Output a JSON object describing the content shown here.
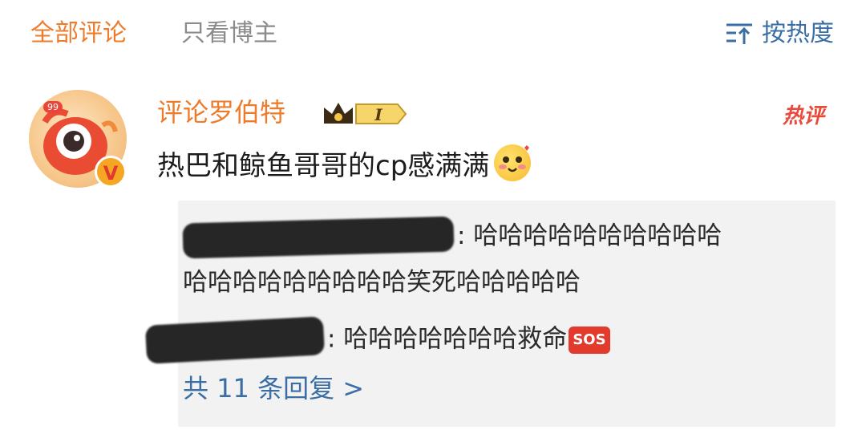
{
  "tabs": {
    "all_comments": "全部评论",
    "blogger_only": "只看博主",
    "sort_label": "按热度",
    "sort_icon": "sort-icon"
  },
  "comment": {
    "avatar_badge": "99",
    "verified_mark": "V",
    "username": "评论罗伯特",
    "level_badge": "I",
    "hot_tag": "热评",
    "text": "热巴和鲸鱼哥哥的cp感满满",
    "emoji": "blushing-face-emoji"
  },
  "replies": {
    "reply1_prefix": ":",
    "reply1_line1": " 哈哈哈哈哈哈哈哈哈哈",
    "reply1_line2": "哈哈哈哈哈哈哈哈哈笑死哈哈哈哈哈",
    "reply2_prefix": ":",
    "reply2_text": " 哈哈哈哈哈哈哈救命",
    "reply2_badge": "SOS",
    "more_label": "共 11 条回复 >"
  },
  "colors": {
    "accent_orange": "#ee7b2a",
    "link_blue": "#3a6ea5",
    "hot_red": "#e84b3c"
  }
}
